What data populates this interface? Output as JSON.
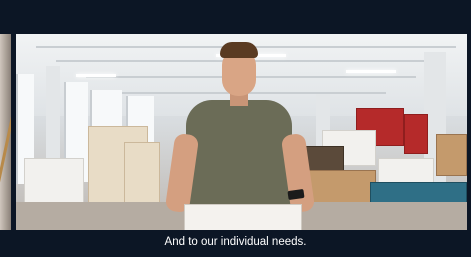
{
  "video": {
    "subtitle": "And to our individual needs."
  },
  "colors": {
    "background": "#0c1625",
    "subtitle_text": "#ffffff",
    "shirt": "#6b6c57",
    "shelf_red": "#b52a2a"
  }
}
